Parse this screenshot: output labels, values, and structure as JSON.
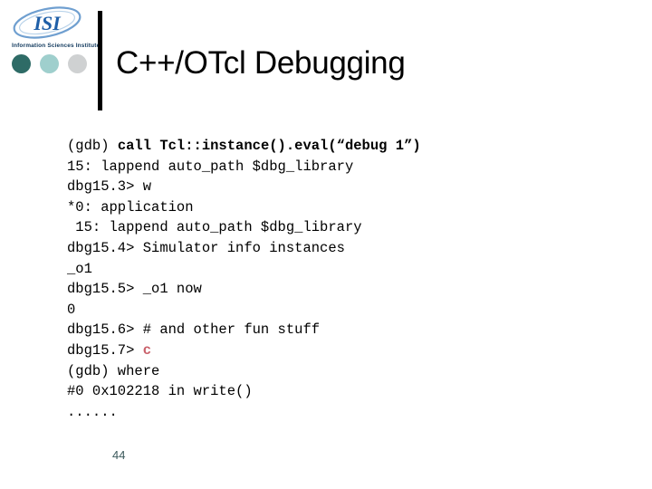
{
  "slide": {
    "title": "C++/OTcl Debugging",
    "page_number": "44"
  },
  "logo": {
    "wordmark": "ISI",
    "caption": "Information Sciences Institute",
    "dots": [
      {
        "name": "dot-dark",
        "color": "#2e6b66"
      },
      {
        "name": "dot-light",
        "color": "#9fcfcd"
      },
      {
        "name": "dot-gray",
        "color": "#cfd1d2"
      }
    ],
    "mark_color": "#1f5fa8"
  },
  "colors": {
    "background": "#ffffff",
    "text": "#000000",
    "divider": "#000000",
    "accent_red": "#c9606a",
    "page_number": "#3c5a5c"
  },
  "transcript": {
    "lines": [
      {
        "id": "line-1",
        "segments": [
          {
            "text": "(gdb) ",
            "style": "normal"
          },
          {
            "text": "call Tcl::instance().eval(“debug 1”)",
            "style": "bold"
          }
        ],
        "plain": "(gdb) call Tcl::instance().eval(“debug 1”)"
      },
      {
        "id": "line-2",
        "segments": [
          {
            "text": "15: lappend auto_path $dbg_library",
            "style": "normal"
          }
        ],
        "plain": "15: lappend auto_path $dbg_library"
      },
      {
        "id": "line-3",
        "segments": [
          {
            "text": "dbg15.3> w",
            "style": "normal"
          }
        ],
        "plain": "dbg15.3> w"
      },
      {
        "id": "line-4",
        "segments": [
          {
            "text": "*0: application",
            "style": "normal"
          }
        ],
        "plain": "*0: application"
      },
      {
        "id": "line-5",
        "segments": [
          {
            "text": " 15: lappend auto_path $dbg_library",
            "style": "normal"
          }
        ],
        "plain": " 15: lappend auto_path $dbg_library"
      },
      {
        "id": "line-6",
        "segments": [
          {
            "text": "dbg15.4> Simulator info instances",
            "style": "normal"
          }
        ],
        "plain": "dbg15.4> Simulator info instances"
      },
      {
        "id": "line-7",
        "segments": [
          {
            "text": "_o1",
            "style": "normal"
          }
        ],
        "plain": "_o1"
      },
      {
        "id": "line-8",
        "segments": [
          {
            "text": "dbg15.5> _o1 now",
            "style": "normal"
          }
        ],
        "plain": "dbg15.5> _o1 now"
      },
      {
        "id": "line-9",
        "segments": [
          {
            "text": "0",
            "style": "normal"
          }
        ],
        "plain": "0"
      },
      {
        "id": "line-10",
        "segments": [
          {
            "text": "dbg15.6> # and other fun stuff",
            "style": "normal"
          }
        ],
        "plain": "dbg15.6> # and other fun stuff"
      },
      {
        "id": "line-11",
        "segments": [
          {
            "text": "dbg15.7> ",
            "style": "normal"
          },
          {
            "text": "c",
            "style": "accent"
          }
        ],
        "plain": "dbg15.7> c"
      },
      {
        "id": "line-12",
        "segments": [
          {
            "text": "(gdb) where",
            "style": "normal"
          }
        ],
        "plain": "(gdb) where"
      },
      {
        "id": "line-13",
        "segments": [
          {
            "text": "#0 0x102218 in write()",
            "style": "normal"
          }
        ],
        "plain": "#0 0x102218 in write()"
      },
      {
        "id": "line-14",
        "segments": [
          {
            "text": "......",
            "style": "normal"
          }
        ],
        "plain": "......"
      }
    ]
  }
}
